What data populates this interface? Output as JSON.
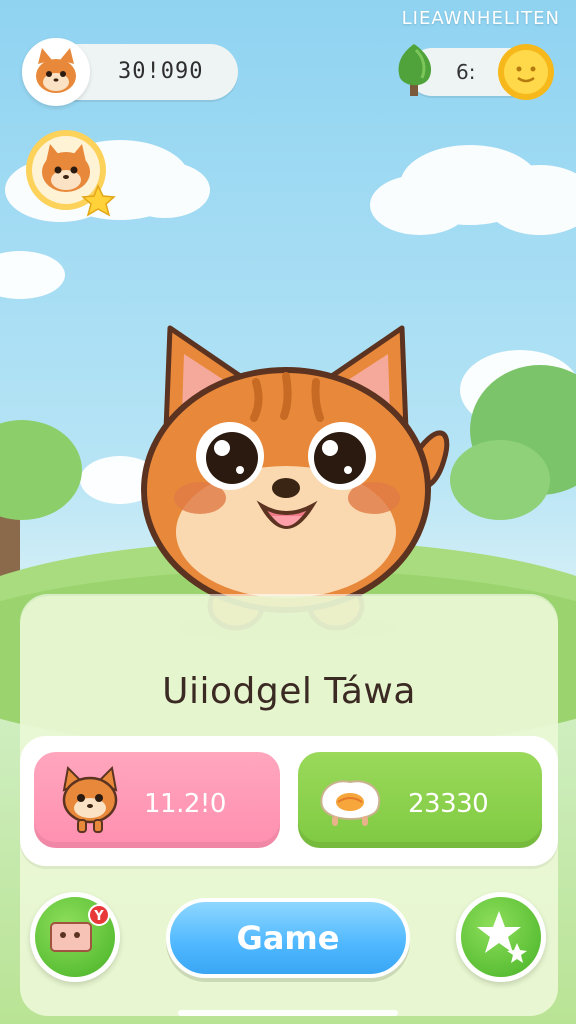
{
  "app": {
    "top_right_label": "LIEAWNHELITEN",
    "coins_value": "30!090",
    "gems_value": "6:",
    "pet_name": "Uiiodgel Táwa",
    "stats": {
      "love_value": "11.2!0",
      "food_value": "23330"
    },
    "buttons": {
      "play_label": "Game",
      "notification_badge": "Y"
    }
  },
  "colors": {
    "sky_top": "#8fd3f1",
    "grass": "#b9e394",
    "panel_bg": "#ecf8d6",
    "pink_stat": "#ff8fb0",
    "green_stat": "#7fca42",
    "play_button": "#4eb7ff",
    "round_button": "#5cc036",
    "cat_orange": "#e8883a"
  },
  "icons": {
    "profile": "cat-face-icon",
    "level": "cat-face-star-icon",
    "currency_left": "coin-icon",
    "currency_right_tree": "tree-icon",
    "currency_right_sun": "sun-coin-icon",
    "love_stat": "cat-face-icon",
    "food_stat": "egg-food-icon",
    "left_action": "letter-icon",
    "right_action": "sparkle-star-icon"
  }
}
